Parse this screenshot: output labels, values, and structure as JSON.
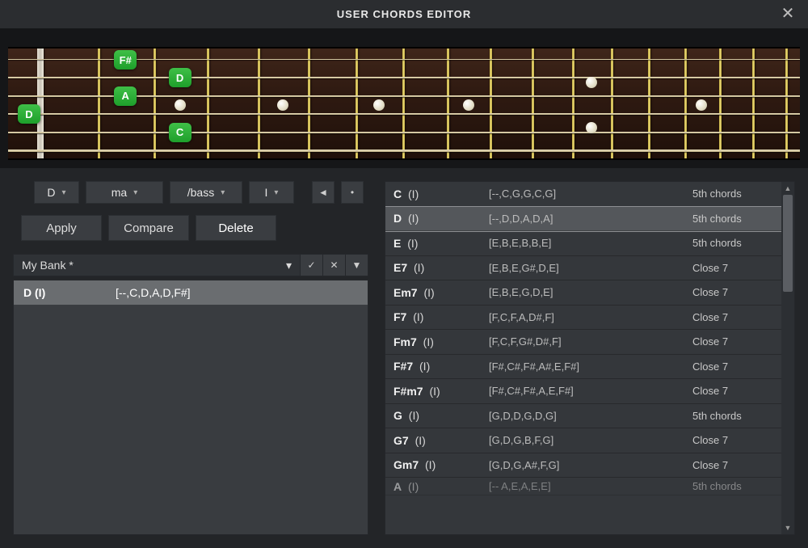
{
  "window": {
    "title": "USER CHORDS EDITOR"
  },
  "fretboard": {
    "notes": [
      {
        "label": "D",
        "string": 4,
        "fret": 0
      },
      {
        "label": "F#",
        "string": 1,
        "fret": 2
      },
      {
        "label": "A",
        "string": 3,
        "fret": 2
      },
      {
        "label": "D",
        "string": 2,
        "fret": 3
      },
      {
        "label": "C",
        "string": 5,
        "fret": 3
      }
    ]
  },
  "selectors": {
    "root": "D",
    "quality": "ma",
    "bass": "/bass",
    "position": "I"
  },
  "actions": {
    "apply": "Apply",
    "compare": "Compare",
    "delete": "Delete"
  },
  "bank": {
    "name": "My Bank *"
  },
  "user_chords": [
    {
      "name_bold": "D",
      "name_suffix": "(I)",
      "notes": "[--,C,D,A,D,F#]"
    }
  ],
  "library": [
    {
      "name_bold": "C",
      "name_suffix": "(I)",
      "notes": "[--,C,G,G,C,G]",
      "category": "5th chords",
      "selected": false
    },
    {
      "name_bold": "D",
      "name_suffix": "(I)",
      "notes": "[--,D,D,A,D,A]",
      "category": "5th chords",
      "selected": true
    },
    {
      "name_bold": "E",
      "name_suffix": "(I)",
      "notes": "[E,B,E,B,B,E]",
      "category": "5th chords",
      "selected": false
    },
    {
      "name_bold": "E7",
      "name_suffix": "(I)",
      "notes": "[E,B,E,G#,D,E]",
      "category": "Close 7",
      "selected": false
    },
    {
      "name_bold": "Em7",
      "name_suffix": "(I)",
      "notes": "[E,B,E,G,D,E]",
      "category": "Close 7",
      "selected": false
    },
    {
      "name_bold": "F7",
      "name_suffix": "(I)",
      "notes": "[F,C,F,A,D#,F]",
      "category": "Close 7",
      "selected": false
    },
    {
      "name_bold": "Fm7",
      "name_suffix": "(I)",
      "notes": "[F,C,F,G#,D#,F]",
      "category": "Close 7",
      "selected": false
    },
    {
      "name_bold": "F#7",
      "name_suffix": "(I)",
      "notes": "[F#,C#,F#,A#,E,F#]",
      "category": "Close 7",
      "selected": false
    },
    {
      "name_bold": "F#m7",
      "name_suffix": "(I)",
      "notes": "[F#,C#,F#,A,E,F#]",
      "category": "Close 7",
      "selected": false
    },
    {
      "name_bold": "G",
      "name_suffix": "(I)",
      "notes": "[G,D,D,G,D,G]",
      "category": "5th chords",
      "selected": false
    },
    {
      "name_bold": "G7",
      "name_suffix": "(I)",
      "notes": "[G,D,G,B,F,G]",
      "category": "Close 7",
      "selected": false
    },
    {
      "name_bold": "Gm7",
      "name_suffix": "(I)",
      "notes": "[G,D,G,A#,F,G]",
      "category": "Close 7",
      "selected": false
    },
    {
      "name_bold": "A",
      "name_suffix": "(I)",
      "notes": "[-- A,E,A,E,E]",
      "category": "5th chords",
      "selected": false,
      "cut": true
    }
  ]
}
